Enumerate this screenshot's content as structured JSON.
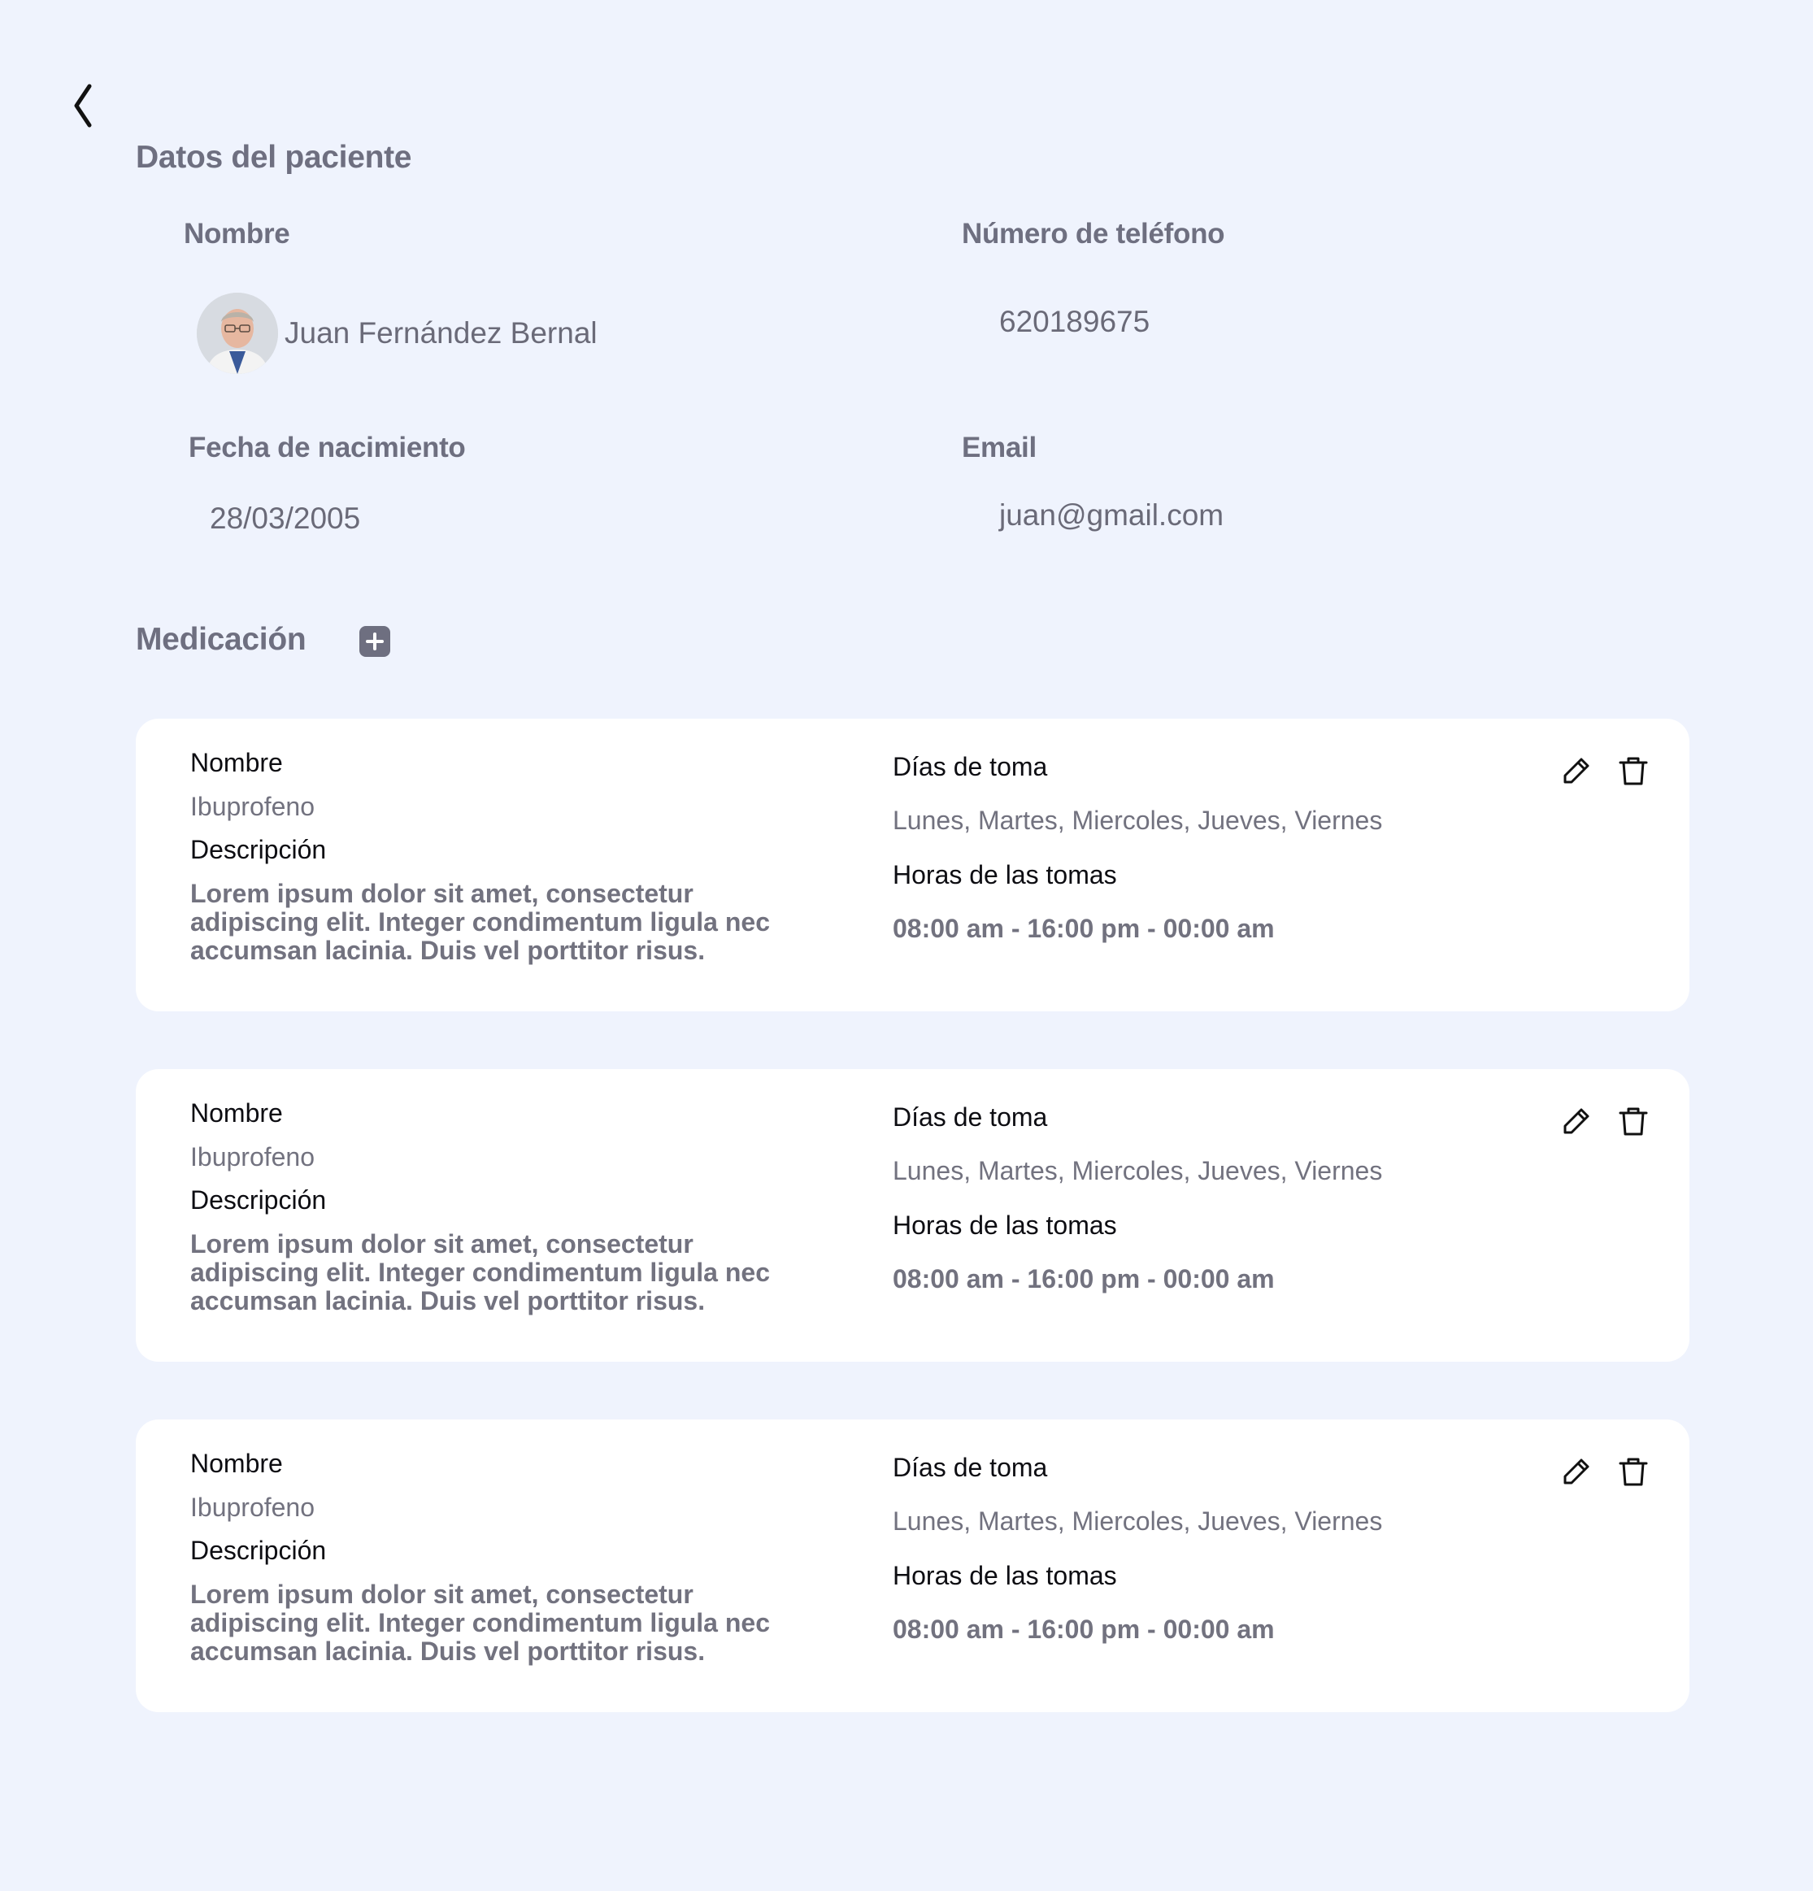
{
  "patient_section": {
    "title": "Datos del paciente",
    "name_label": "Nombre",
    "name_value": "Juan Fernández Bernal",
    "phone_label": "Número de teléfono",
    "phone_value": "620189675",
    "birth_label": "Fecha de nacimiento",
    "birth_value": "28/03/2005",
    "email_label": "Email",
    "email_value": "juan@gmail.com"
  },
  "medication_section": {
    "title": "Medicación"
  },
  "medications": [
    {
      "name_label": "Nombre",
      "name_value": "Ibuprofeno",
      "desc_label": "Descripción",
      "desc_value": "Lorem ipsum dolor sit amet, consectetur adipiscing elit. Integer condimentum ligula nec accumsan lacinia. Duis vel porttitor risus.",
      "days_label": "Días de toma",
      "days_value": "Lunes, Martes, Miercoles, Jueves, Viernes",
      "hours_label": "Horas de las tomas",
      "hours_value": "08:00 am - 16:00 pm - 00:00 am"
    },
    {
      "name_label": "Nombre",
      "name_value": "Ibuprofeno",
      "desc_label": "Descripción",
      "desc_value": "Lorem ipsum dolor sit amet, consectetur adipiscing elit. Integer condimentum ligula nec accumsan lacinia. Duis vel porttitor risus.",
      "days_label": "Días de toma",
      "days_value": "Lunes, Martes, Miercoles, Jueves, Viernes",
      "hours_label": "Horas de las tomas",
      "hours_value": "08:00 am - 16:00 pm - 00:00 am"
    },
    {
      "name_label": "Nombre",
      "name_value": "Ibuprofeno",
      "desc_label": "Descripción",
      "desc_value": "Lorem ipsum dolor sit amet, consectetur adipiscing elit. Integer condimentum ligula nec accumsan lacinia. Duis vel porttitor risus.",
      "days_label": "Días de toma",
      "days_value": "Lunes, Martes, Miercoles, Jueves, Viernes",
      "hours_label": "Horas de las tomas",
      "hours_value": "08:00 am - 16:00 pm - 00:00 am"
    }
  ],
  "icons": {
    "back": "chevron-left-icon",
    "add": "plus-square-icon",
    "edit": "pencil-icon",
    "delete": "trash-icon"
  },
  "colors": {
    "background": "#eff3fd",
    "card": "#ffffff",
    "muted_text": "#6e6f80"
  }
}
